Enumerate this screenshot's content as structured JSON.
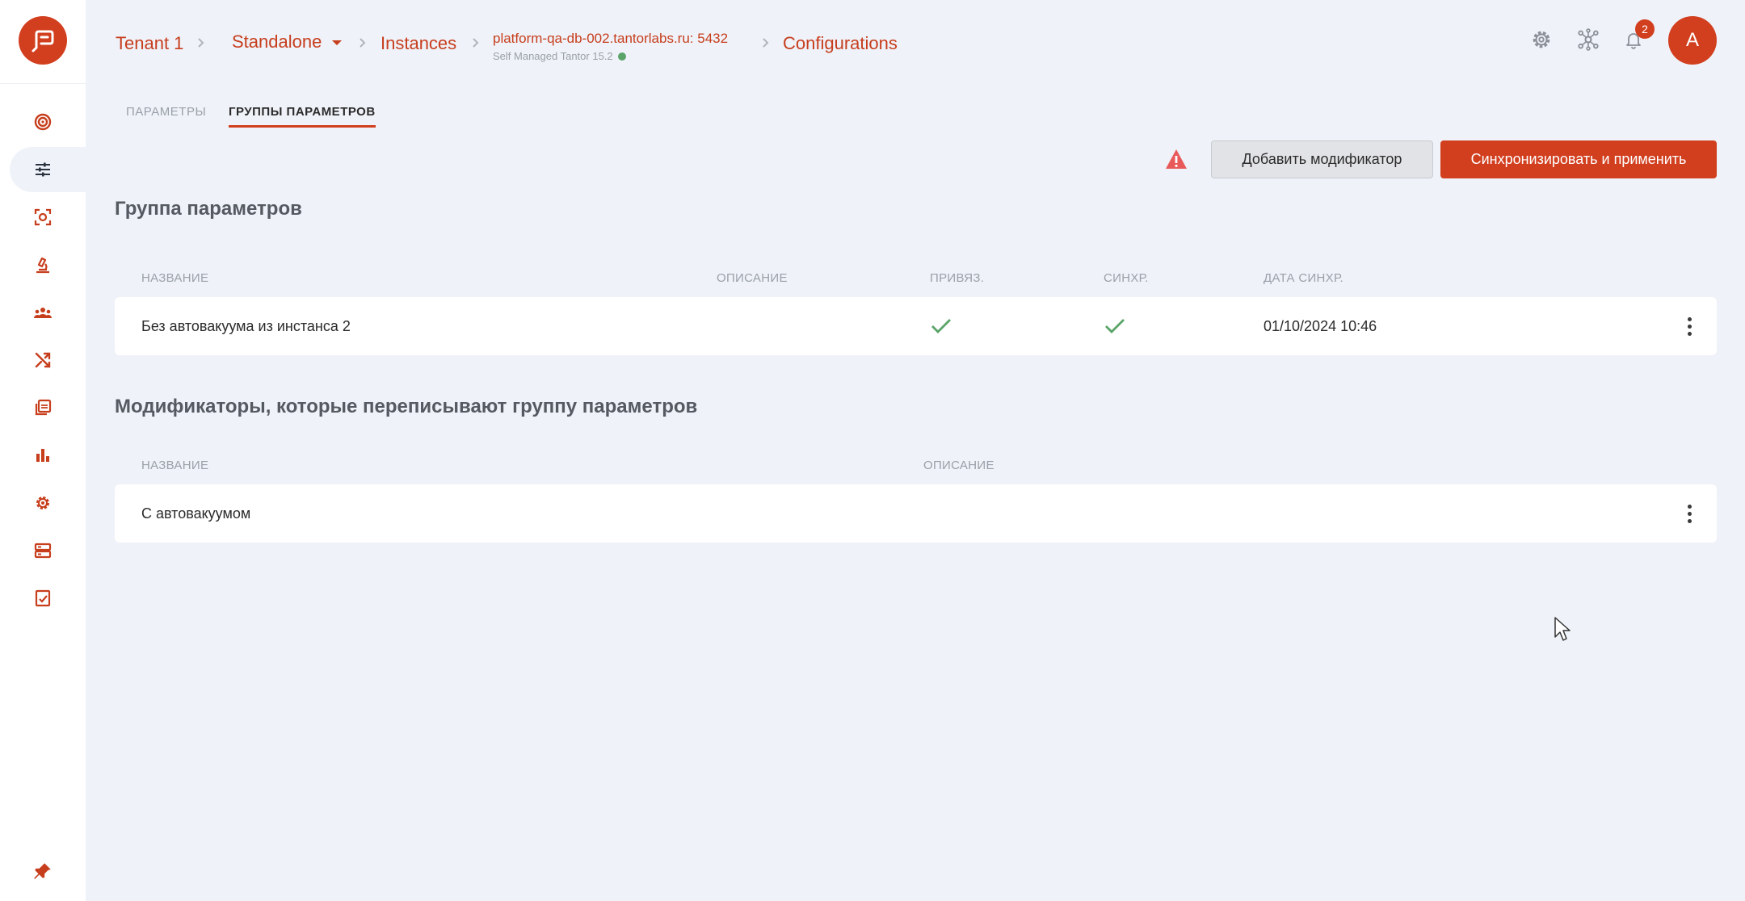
{
  "header": {
    "tenant": "Tenant 1",
    "cluster_type": "Standalone",
    "instances": "Instances",
    "instance_name": "platform-qa-db-002.tantorlabs.ru: 5432",
    "instance_sub": "Self Managed Tantor 15.2",
    "configurations": "Configurations",
    "notifications_count": "2",
    "avatar_letter": "A"
  },
  "tabs": [
    {
      "label": "ПАРАМЕТРЫ",
      "active": false
    },
    {
      "label": "ГРУППЫ ПАРАМЕТРОВ",
      "active": true
    }
  ],
  "actions": {
    "add_modifier": "Добавить модификатор",
    "sync_apply": "Синхронизировать и применить"
  },
  "param_group": {
    "title": "Группа параметров",
    "columns": [
      "НАЗВАНИЕ",
      "ОПИСАНИЕ",
      "ПРИВЯЗ.",
      "СИНХР.",
      "ДАТА СИНХР."
    ],
    "rows": [
      {
        "name": "Без автовакуума из инстанса 2",
        "description": "",
        "bound": true,
        "synced": true,
        "sync_date": "01/10/2024 10:46"
      }
    ]
  },
  "modifiers": {
    "title": "Модификаторы, которые переписывают группу параметров",
    "columns": [
      "НАЗВАНИЕ",
      "ОПИСАНИЕ"
    ],
    "rows": [
      {
        "name": "С автовакуумом",
        "description": ""
      }
    ]
  },
  "sidebar": {
    "items": [
      {
        "icon": "target-icon",
        "active": false
      },
      {
        "icon": "sliders-icon",
        "active": true
      },
      {
        "icon": "scan-icon",
        "active": false
      },
      {
        "icon": "microscope-icon",
        "active": false
      },
      {
        "icon": "users-icon",
        "active": false
      },
      {
        "icon": "shuffle-icon",
        "active": false
      },
      {
        "icon": "layers-icon",
        "active": false
      },
      {
        "icon": "bar-chart-icon",
        "active": false
      },
      {
        "icon": "gear-icon",
        "active": false
      },
      {
        "icon": "server-icon",
        "active": false
      },
      {
        "icon": "checklist-icon",
        "active": false
      }
    ],
    "pin_icon": "pin-icon"
  },
  "colors": {
    "accent": "#d23f1f",
    "background": "#eff2f8",
    "success": "#5aa469",
    "muted": "#9aa0a9"
  }
}
